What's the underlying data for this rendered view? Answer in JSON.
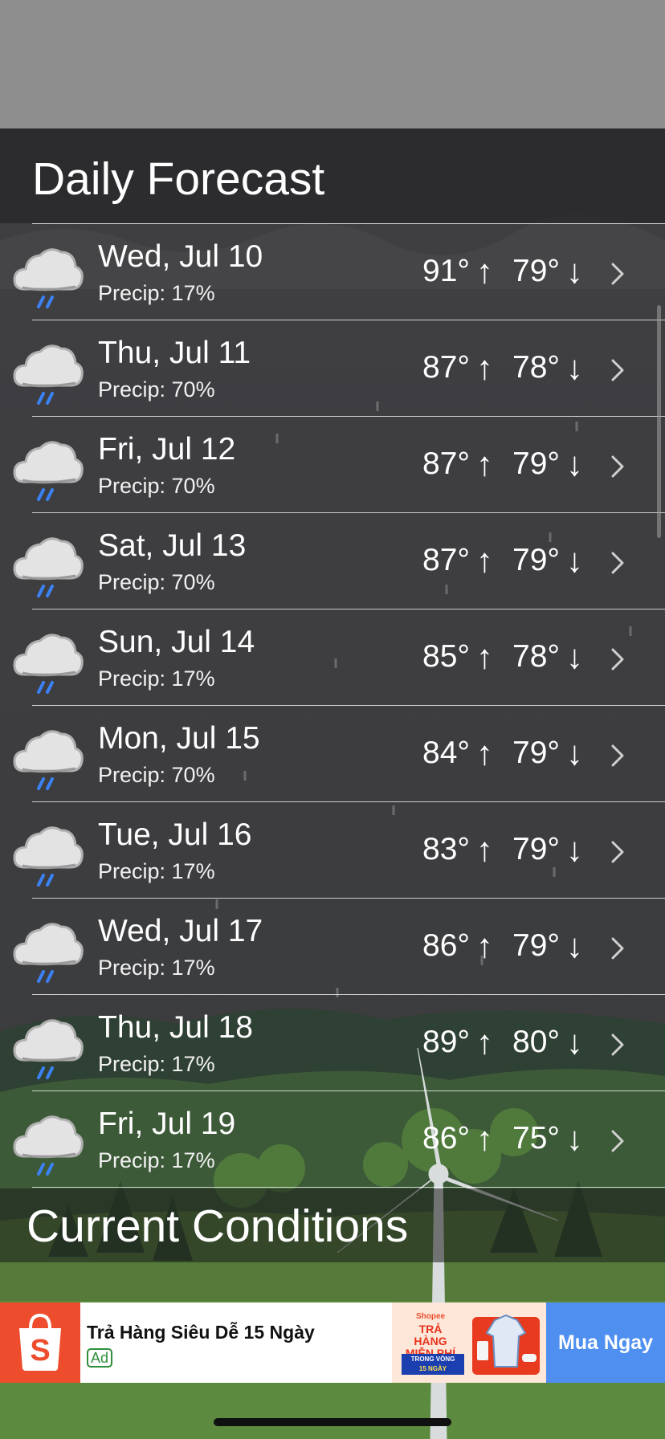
{
  "daily_forecast": {
    "title": "Daily Forecast",
    "days": [
      {
        "date": "Wed, Jul 10",
        "precip": "Precip: 17%",
        "high": "91°",
        "low": "79°"
      },
      {
        "date": "Thu, Jul 11",
        "precip": "Precip: 70%",
        "high": "87°",
        "low": "78°"
      },
      {
        "date": "Fri, Jul 12",
        "precip": "Precip: 70%",
        "high": "87°",
        "low": "79°"
      },
      {
        "date": "Sat, Jul 13",
        "precip": "Precip: 70%",
        "high": "87°",
        "low": "79°"
      },
      {
        "date": "Sun, Jul 14",
        "precip": "Precip: 17%",
        "high": "85°",
        "low": "78°"
      },
      {
        "date": "Mon, Jul 15",
        "precip": "Precip: 70%",
        "high": "84°",
        "low": "79°"
      },
      {
        "date": "Tue, Jul 16",
        "precip": "Precip: 17%",
        "high": "83°",
        "low": "79°"
      },
      {
        "date": "Wed, Jul 17",
        "precip": "Precip: 17%",
        "high": "86°",
        "low": "79°"
      },
      {
        "date": "Thu, Jul 18",
        "precip": "Precip: 17%",
        "high": "89°",
        "low": "80°"
      },
      {
        "date": "Fri, Jul 19",
        "precip": "Precip: 17%",
        "high": "86°",
        "low": "75°"
      }
    ],
    "arrow_up": "↑",
    "arrow_down": "↓",
    "row_icon": "rain-cloud-icon"
  },
  "current_conditions": {
    "title": "Current Conditions"
  },
  "ad": {
    "title": "Trả Hàng Siêu Dễ 15 Ngày",
    "badge": "Ad",
    "creative_brand": "Shopee",
    "creative_headline": "TRẢ HÀNG MIỄN PHÍ",
    "creative_pill_line1": "TRONG VÒNG",
    "creative_pill_line2": "15 NGÀY",
    "cta": "Mua Ngay",
    "logo_icon": "shopping-bag-icon",
    "logo_color": "#ee4d2d",
    "cta_color": "#4f8ff0"
  },
  "theme": {
    "top_area_color": "#8e8e8e",
    "rain_drop_color": "#3b82f6"
  }
}
